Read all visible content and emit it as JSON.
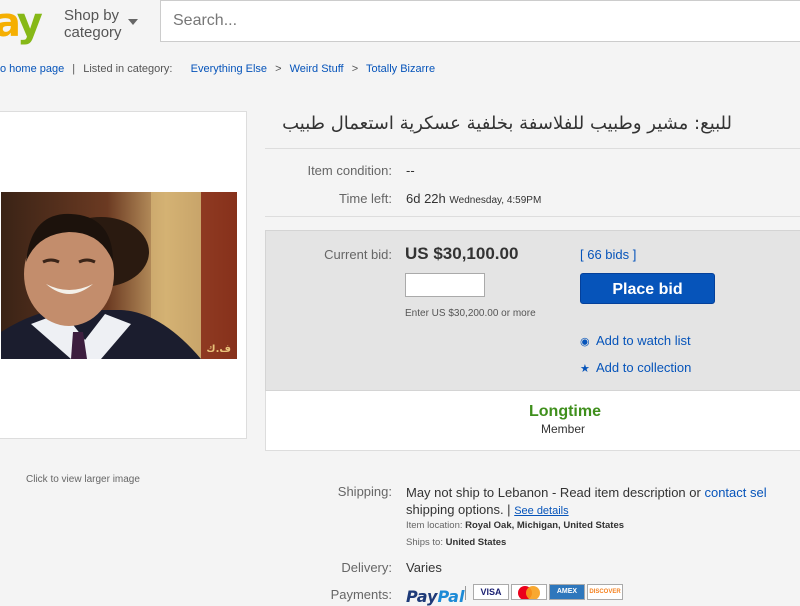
{
  "header": {
    "logo_visible": "ay",
    "shop_by": "Shop by\ncategory",
    "search_placeholder": "Search..."
  },
  "breadcrumb": {
    "back": "o home page",
    "listed_in": "Listed in category:",
    "path": [
      "Everything Else",
      "Weird Stuff",
      "Totally Bizarre"
    ],
    "separator": ">"
  },
  "image_panel": {
    "click_to_view": "Click to view larger image",
    "watermark": "ف.ك"
  },
  "item": {
    "title": "للبيع: مشير وطبيب للفلاسفة بخلفية عسكرية استعمال طبيب",
    "condition_label": "Item condition:",
    "condition_value": "--",
    "time_left_label": "Time left:",
    "time_left_value": "6d 22h",
    "time_left_detail": "Wednesday, 4:59PM"
  },
  "bid": {
    "current_bid_label": "Current bid:",
    "current_bid_value": "US $30,100.00",
    "bids_link": "[ 66 bids ]",
    "input_value": "",
    "enter_note": "Enter US $30,200.00 or more",
    "place_bid": "Place bid",
    "watch_list": "Add to watch list",
    "collection": "Add to collection"
  },
  "seller": {
    "longtime": "Longtime",
    "member": "Member"
  },
  "shipping": {
    "label": "Shipping:",
    "text_line1": "May not ship to Lebanon - Read item description or",
    "contact_link": "contact sel",
    "text_line2": "shipping options. |",
    "see_details": "See details",
    "location_label": "Item location:",
    "location_value": "Royal Oak, Michigan, United States",
    "ships_to_label": "Ships to:",
    "ships_to_value": "United States"
  },
  "delivery": {
    "label": "Delivery:",
    "value": "Varies"
  },
  "payments": {
    "label": "Payments:",
    "paypal_a": "Pay",
    "paypal_b": "Pal",
    "cards": [
      "VISA",
      "MasterCard",
      "AMEX",
      "DISCOVER"
    ]
  },
  "colors": {
    "link": "#0654ba",
    "button": "#0654ba",
    "longtime": "#3f8f1c",
    "logo_a": "#f5af02",
    "logo_y": "#86b817"
  }
}
